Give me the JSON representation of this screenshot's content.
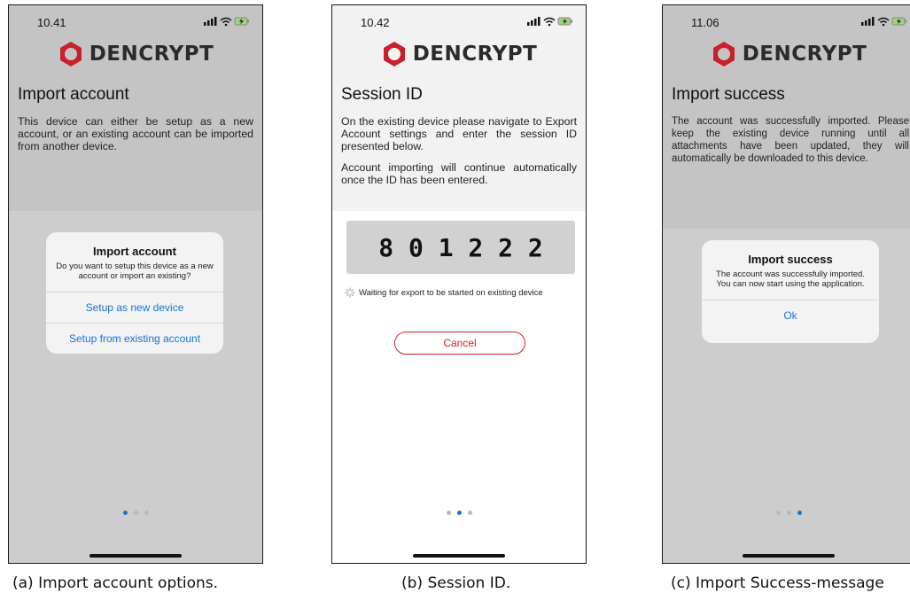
{
  "colors": {
    "accent": "#1a73d9",
    "cancel": "#d42020",
    "logo_red": "#c8202c",
    "dim_overlay": "#cdcdcd"
  },
  "panels": [
    {
      "time": "10.41",
      "status_icons": "signal-icon wifi-icon battery-charging-icon",
      "logo": "DENCRYPT",
      "title": "Import account",
      "description": "This device can either be setup as a new account, or an existing account can be imported from another device.",
      "dialog": {
        "title": "Import account",
        "message": "Do you want to setup this device as a new account or import an existing?",
        "buttons": [
          "Setup as new device",
          "Setup from existing account"
        ]
      },
      "page_indicator": {
        "count": 3,
        "active": 0
      },
      "caption": "(a) Import account options."
    },
    {
      "time": "10.42",
      "logo": "DENCRYPT",
      "title": "Session ID",
      "description_1": "On the existing device please navigate to Export Account settings and enter the session ID presented below.",
      "description_2": "Account importing will continue automatically once the ID has been entered.",
      "session_id": "8 0 1 2 2 2",
      "waiting_text": "Waiting for export to be started on existing device",
      "cancel_label": "Cancel",
      "page_indicator": {
        "count": 3,
        "active": 1
      },
      "caption": "(b) Session ID."
    },
    {
      "time": "11.06",
      "logo": "DENCRYPT",
      "title": "Import success",
      "description": "The account was successfully imported. Please keep the existing device running until all attachments have been updated, they will automatically be downloaded to this device.",
      "dialog": {
        "title": "Import success",
        "message": "The account was successfully imported. You can now start using the application.",
        "button": "Ok"
      },
      "page_indicator": {
        "count": 3,
        "active": 2
      },
      "caption": "(c) Import Success-message"
    }
  ]
}
